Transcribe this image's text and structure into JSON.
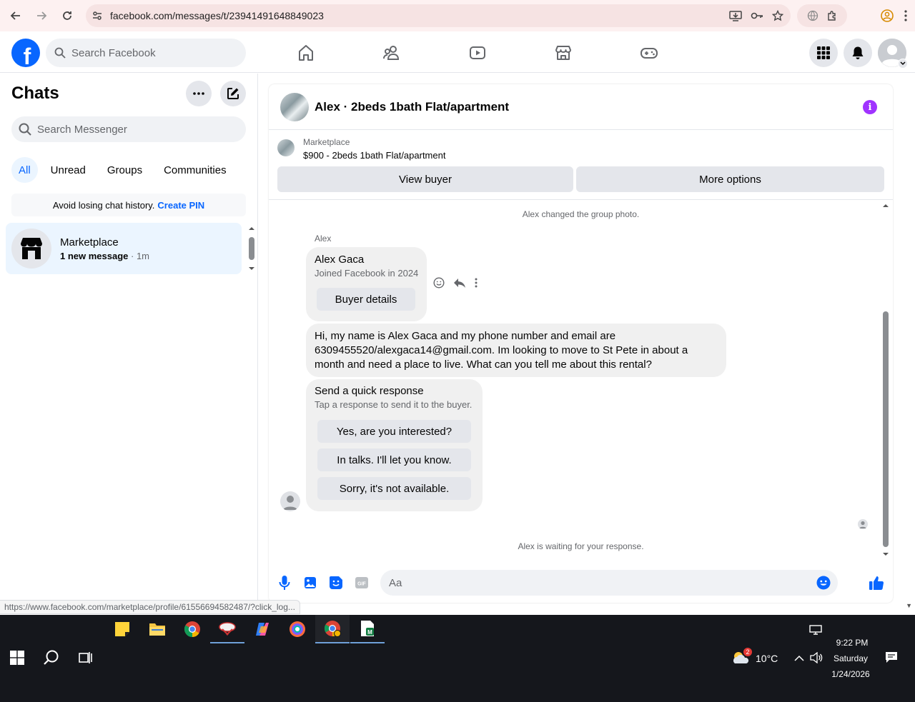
{
  "browser": {
    "url": "facebook.com/messages/t/23941491648849023",
    "status_url": "https://www.facebook.com/marketplace/profile/61556694582487/?click_log..."
  },
  "facebook": {
    "search_placeholder": "Search Facebook"
  },
  "sidebar": {
    "title": "Chats",
    "search_placeholder": "Search Messenger",
    "filters": [
      "All",
      "Unread",
      "Groups",
      "Communities"
    ],
    "pin_banner": {
      "text": "Avoid losing chat history.",
      "link": "Create PIN"
    },
    "chats": [
      {
        "name": "Marketplace",
        "preview": "1 new message",
        "time": "· 1m"
      }
    ]
  },
  "conversation": {
    "title": "Alex · 2beds 1bath Flat/apartment",
    "marketplace": {
      "label": "Marketplace",
      "listing": "$900 - 2beds 1bath Flat/apartment",
      "view_buyer": "View buyer",
      "more_options": "More options"
    },
    "system_top": "Alex changed the group photo.",
    "sender": "Alex",
    "buyer_card": {
      "name": "Alex Gaca",
      "joined": "Joined Facebook in 2024",
      "button": "Buyer details"
    },
    "message": "Hi, my name is Alex Gaca and my phone number and email are 6309455520/alexgaca14@gmail.com. Im looking to move to St Pete in about a month and need a place to live. What can you tell me about this rental?",
    "quick_response": {
      "title": "Send a quick response",
      "subtitle": "Tap a response to send it to the buyer.",
      "options": [
        "Yes, are you interested?",
        "In talks. I'll let you know.",
        "Sorry, it's not available."
      ]
    },
    "system_bottom": "Alex is waiting for your response.",
    "composer_placeholder": "Aa"
  },
  "taskbar": {
    "weather": "10°C",
    "weather_badge": "2",
    "time": "9:22 PM",
    "day": "Saturday",
    "date": "1/24/2026"
  },
  "colors": {
    "fb_blue": "#0866ff",
    "info_purple": "#a033ff",
    "taskbar_bg": "#15171c"
  }
}
